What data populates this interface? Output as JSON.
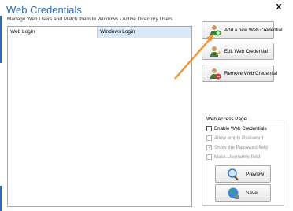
{
  "window": {
    "title": "Web Credentials",
    "close_glyph": "x",
    "subtitle": "Manage Web Users and Match them to Windows / Active Directory Users"
  },
  "listview": {
    "columns": [
      "Web Login",
      "Windows Login"
    ],
    "rows": []
  },
  "actions": {
    "add": {
      "label": "Add a new Web Credential",
      "icon": "add-user-icon"
    },
    "edit": {
      "label": "Edit Web Credential",
      "icon": "edit-user-icon"
    },
    "remove": {
      "label": "Remove Web Credential",
      "icon": "remove-user-icon"
    }
  },
  "web_access": {
    "group_title": "Web Access Page",
    "enable": {
      "label": "Enable Web Credentials",
      "checked": false,
      "enabled": true
    },
    "allow_empty": {
      "label": "Allow empty Password",
      "checked": false,
      "enabled": false
    },
    "show_password": {
      "label": "Show the Password field",
      "checked": true,
      "enabled": false
    },
    "mask_username": {
      "label": "Mask Username field",
      "checked": false,
      "enabled": false
    },
    "preview_label": "Preview",
    "save_label": "Save"
  },
  "colors": {
    "title": "#2f6eb5",
    "selected_column": "#dbe8f7",
    "annotation_arrow": "#f0922e"
  }
}
